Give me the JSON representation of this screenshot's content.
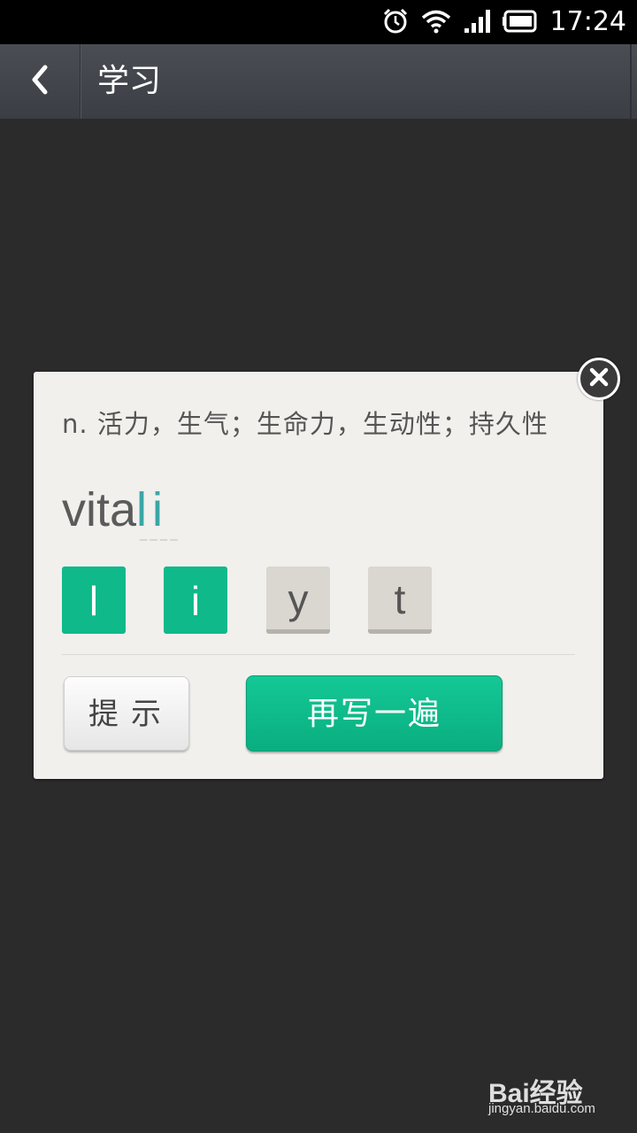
{
  "status_bar": {
    "time": "17:24",
    "icons": [
      "alarm-icon",
      "wifi-icon",
      "signal-icon",
      "battery-icon"
    ]
  },
  "header": {
    "title": "学习",
    "back_icon": "chevron-left-icon"
  },
  "dialog": {
    "definition": "n. 活力，生气；生命力，生动性；持久性",
    "word_known": "vita",
    "word_typed": "li",
    "blanks": "————",
    "letters": [
      "l",
      "i",
      "y",
      "t"
    ],
    "letters_used": [
      true,
      true,
      false,
      false
    ],
    "hint_label": "提示",
    "rewrite_label": "再写一遍"
  },
  "watermark": {
    "logo": "Bai经验",
    "url": "jingyan.baidu.com"
  },
  "colors": {
    "accent_green": "#0fb98a",
    "typed_text": "#3aa6a6",
    "dialog_bg": "#f1f0ed",
    "page_bg": "#2b2b2b"
  }
}
